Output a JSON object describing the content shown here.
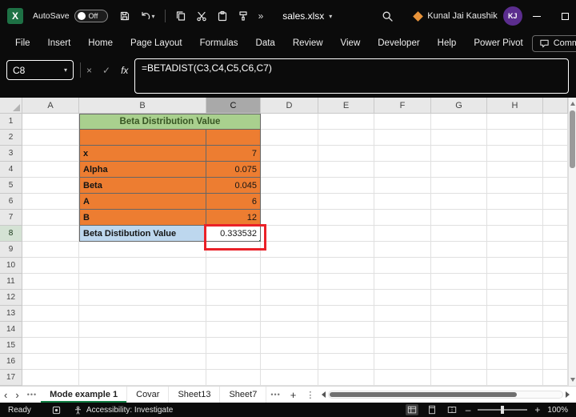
{
  "colors": {
    "chrome-bg": "#0B0B0B",
    "accent-green": "#107C41",
    "title-green-bg": "#A9D08E",
    "title-green-text": "#375623",
    "orange": "#ED7D31",
    "blue": "#BDD7EE",
    "annotation-red": "#EA2128",
    "header-bg": "#E8E8E8",
    "header-sel-bg": "#A9A9A9",
    "row-sel-bg": "#D4E2D4",
    "grid-line": "#E0E0E0",
    "table-border": "#666666",
    "avatar-bg": "#5B2D8E"
  },
  "icons": {
    "chevron-down": "▾",
    "more-chevrons": "»",
    "dots": "•••",
    "close": "×",
    "cancel": "×",
    "check": "✓",
    "plus": "+",
    "minus": "–",
    "nav-left": "‹",
    "nav-right": "›",
    "kebab": "⋮",
    "logo-letter": "X"
  },
  "titlebar": {
    "autosave_label": "AutoSave",
    "autosave_state": "Off",
    "filename": "sales.xlsx",
    "user_name": "Kunal Jai Kaushik",
    "user_initials": "KJ"
  },
  "ribbon": {
    "tabs": [
      "File",
      "Insert",
      "Home",
      "Page Layout",
      "Formulas",
      "Data",
      "Review",
      "View",
      "Developer",
      "Help",
      "Power Pivot"
    ],
    "comments_label": "Comments"
  },
  "formula_bar": {
    "name_box_value": "C8",
    "fx_label": "fx",
    "formula": "=BETADIST(C3,C4,C5,C6,C7)"
  },
  "grid": {
    "columns": [
      "A",
      "B",
      "C",
      "D",
      "E",
      "F",
      "G",
      "H"
    ],
    "row_count": 17,
    "selected_column": "C",
    "selected_row": 8,
    "cells": {
      "B1": {
        "text": "Beta Distribution Value",
        "style": "title",
        "span": 2
      },
      "B2": {
        "text": "",
        "style": "orange_label"
      },
      "C2": {
        "text": "",
        "style": "orange_value"
      },
      "B3": {
        "text": "x",
        "style": "orange_label"
      },
      "C3": {
        "text": "7",
        "style": "orange_value"
      },
      "B4": {
        "text": "Alpha",
        "style": "orange_label"
      },
      "C4": {
        "text": "0.075",
        "style": "orange_value"
      },
      "B5": {
        "text": "Beta",
        "style": "orange_label"
      },
      "C5": {
        "text": "0.045",
        "style": "orange_value"
      },
      "B6": {
        "text": "A",
        "style": "orange_label"
      },
      "C6": {
        "text": "6",
        "style": "orange_value"
      },
      "B7": {
        "text": "B",
        "style": "orange_label"
      },
      "C7": {
        "text": "12",
        "style": "orange_value"
      },
      "B8": {
        "text": "Beta Distibution Value",
        "style": "blue_label"
      },
      "C8": {
        "text": "0.333532",
        "style": "result"
      }
    }
  },
  "sheet_tabs": {
    "tabs": [
      {
        "label": "Mode example 1",
        "active": true
      },
      {
        "label": "Covar",
        "active": false
      },
      {
        "label": "Sheet13",
        "active": false
      },
      {
        "label": "Sheet7",
        "active": false
      }
    ]
  },
  "status_bar": {
    "ready_label": "Ready",
    "accessibility_label": "Accessibility: Investigate",
    "zoom_level": "100%"
  }
}
